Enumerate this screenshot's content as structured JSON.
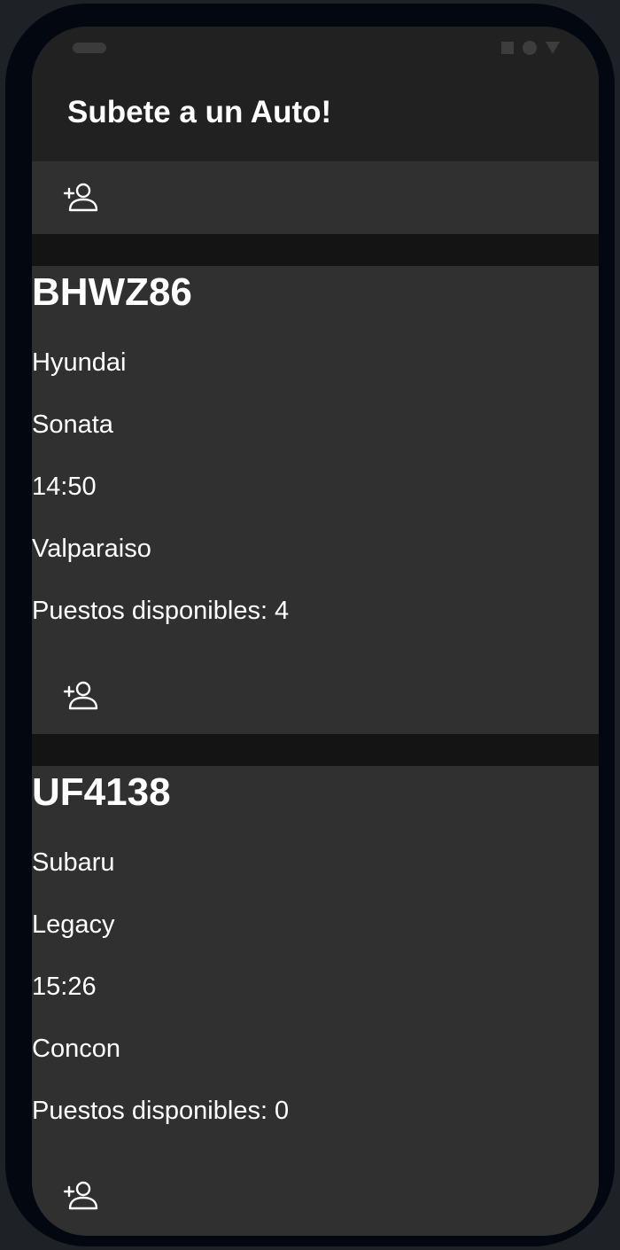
{
  "app": {
    "title": "Subete a un Auto!"
  },
  "icons": {
    "add_passenger": "add-person-icon"
  },
  "colors": {
    "app_bar": "#212121",
    "card_background": "#303030",
    "divider": "#141414",
    "text": "#ffffff"
  },
  "cars": [
    {
      "plate": "BHWZ86",
      "brand": "Hyundai",
      "model": "Sonata",
      "time": "14:50",
      "destination": "Valparaiso",
      "seats": "Puestos disponibles: 4"
    },
    {
      "plate": "UF4138",
      "brand": "Subaru",
      "model": "Legacy",
      "time": "15:26",
      "destination": "Concon",
      "seats": "Puestos disponibles: 0"
    }
  ]
}
